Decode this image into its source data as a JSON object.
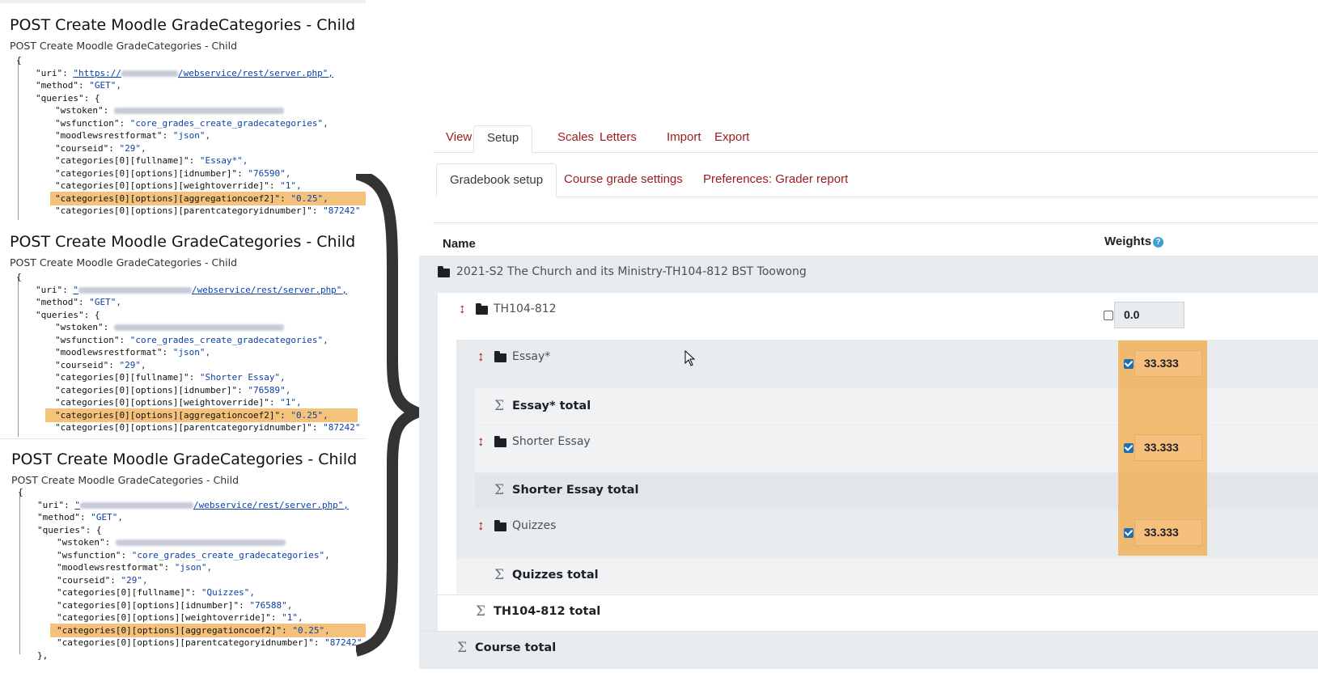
{
  "requests": [
    {
      "title": "POST Create Moodle GradeCategories - Child",
      "subtitle": "POST Create Moodle GradeCategories - Child",
      "open_brace": "{",
      "close_brace": "",
      "lines": [
        {
          "key": "\"uri\"",
          "value": "\"https://",
          "url_tail": "/webservice/rest/server.php\","
        },
        {
          "key": "\"method\"",
          "value": "\"GET\","
        },
        {
          "key": "\"queries\"",
          "value": "{"
        },
        {
          "key": "\"wstoken\"",
          "value": "",
          "blurred": true
        },
        {
          "key": "\"wsfunction\"",
          "value": "\"core_grades_create_gradecategories\","
        },
        {
          "key": "\"moodlewsrestformat\"",
          "value": "\"json\","
        },
        {
          "key": "\"courseid\"",
          "value": "\"29\","
        },
        {
          "key": "\"categories[0][fullname]\"",
          "value": "\"Essay*\","
        },
        {
          "key": "\"categories[0][options][idnumber]\"",
          "value": "\"76590\","
        },
        {
          "key": "\"categories[0][options][weightoverride]\"",
          "value": "\"1\","
        },
        {
          "key": "\"categories[0][options][aggregationcoef2]\"",
          "value": "\"0.25\",",
          "highlight": true
        },
        {
          "key": "\"categories[0][options][parentcategoryidnumber]\"",
          "value": "\"87242\""
        }
      ]
    },
    {
      "title": "POST Create Moodle GradeCategories - Child",
      "subtitle": "POST Create Moodle GradeCategories - Child",
      "open_brace": "{",
      "close_brace": "",
      "lines": [
        {
          "key": "\"uri\"",
          "value": "\"",
          "url_tail": "/webservice/rest/server.php\",",
          "blurred_url": true
        },
        {
          "key": "\"method\"",
          "value": "\"GET\","
        },
        {
          "key": "\"queries\"",
          "value": "{"
        },
        {
          "key": "\"wstoken\"",
          "value": "",
          "blurred": true
        },
        {
          "key": "\"wsfunction\"",
          "value": "\"core_grades_create_gradecategories\","
        },
        {
          "key": "\"moodlewsrestformat\"",
          "value": "\"json\","
        },
        {
          "key": "\"courseid\"",
          "value": "\"29\","
        },
        {
          "key": "\"categories[0][fullname]\"",
          "value": "\"Shorter Essay\","
        },
        {
          "key": "\"categories[0][options][idnumber]\"",
          "value": "\"76589\","
        },
        {
          "key": "\"categories[0][options][weightoverride]\"",
          "value": "\"1\","
        },
        {
          "key": "\"categories[0][options][aggregationcoef2]\"",
          "value": "\"0.25\",",
          "highlight": true
        },
        {
          "key": "\"categories[0][options][parentcategoryidnumber]\"",
          "value": "\"87242\""
        }
      ]
    },
    {
      "title": "POST Create Moodle GradeCategories - Child",
      "subtitle": "POST Create Moodle GradeCategories - Child",
      "open_brace": "{",
      "close_brace": "},",
      "lines": [
        {
          "key": "\"uri\"",
          "value": "\"",
          "url_tail": "/webservice/rest/server.php\",",
          "blurred_url": true
        },
        {
          "key": "\"method\"",
          "value": "\"GET\","
        },
        {
          "key": "\"queries\"",
          "value": "{"
        },
        {
          "key": "\"wstoken\"",
          "value": "",
          "blurred": true
        },
        {
          "key": "\"wsfunction\"",
          "value": "\"core_grades_create_gradecategories\","
        },
        {
          "key": "\"moodlewsrestformat\"",
          "value": "\"json\","
        },
        {
          "key": "\"courseid\"",
          "value": "\"29\","
        },
        {
          "key": "\"categories[0][fullname]\"",
          "value": "\"Quizzes\","
        },
        {
          "key": "\"categories[0][options][idnumber]\"",
          "value": "\"76588\","
        },
        {
          "key": "\"categories[0][options][weightoverride]\"",
          "value": "\"1\","
        },
        {
          "key": "\"categories[0][options][aggregationcoef2]\"",
          "value": "\"0.25\",",
          "highlight": true
        },
        {
          "key": "\"categories[0][options][parentcategoryidnumber]\"",
          "value": "\"87242\""
        }
      ]
    }
  ],
  "moodle": {
    "primary_tabs": [
      "View",
      "Setup",
      "Scales",
      "Letters",
      "Import",
      "Export"
    ],
    "primary_active": "Setup",
    "secondary_tabs": [
      "Gradebook setup",
      "Course grade settings",
      "Preferences: Grader report"
    ],
    "secondary_active": "Gradebook setup",
    "columns": {
      "name": "Name",
      "weights": "Weights"
    },
    "course_category": "2021-S2 The Church and its Ministry-TH104-812 BST Toowong",
    "parent_category": {
      "name": "TH104-812",
      "weight": "0.0",
      "weight_checked": false
    },
    "children": [
      {
        "name": "Essay*",
        "weight": "33.333",
        "checked": true,
        "total": "Essay* total"
      },
      {
        "name": "Shorter Essay",
        "weight": "33.333",
        "checked": true,
        "total": "Shorter Essay total"
      },
      {
        "name": "Quizzes",
        "weight": "33.333",
        "checked": true,
        "total": "Quizzes total"
      }
    ],
    "parent_total": "TH104-812 total",
    "course_total": "Course total"
  },
  "colors": {
    "highlight": "#f5c27c",
    "link": "#9d1a1f",
    "string": "#0b3fa5"
  }
}
